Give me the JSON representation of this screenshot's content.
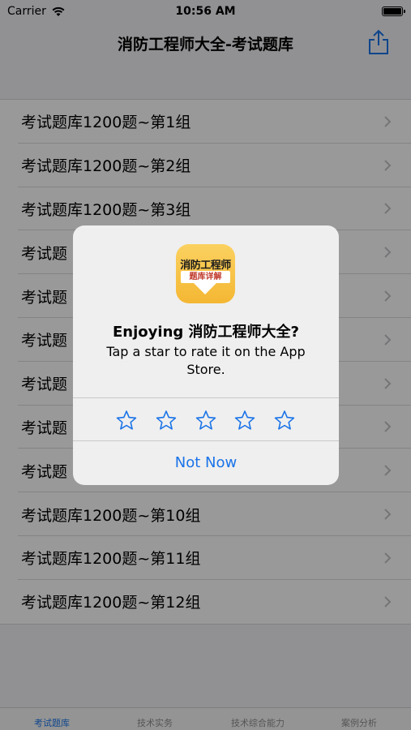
{
  "status_bar": {
    "carrier": "Carrier",
    "time": "10:56 AM"
  },
  "nav": {
    "title": "消防工程师大全-考试题库",
    "share_icon": "share-icon"
  },
  "list": {
    "items": [
      {
        "label": "考试题库1200题~第1组"
      },
      {
        "label": "考试题库1200题~第2组"
      },
      {
        "label": "考试题库1200题~第3组"
      },
      {
        "label": "考试题"
      },
      {
        "label": "考试题"
      },
      {
        "label": "考试题"
      },
      {
        "label": "考试题"
      },
      {
        "label": "考试题"
      },
      {
        "label": "考试题"
      },
      {
        "label": "考试题库1200题~第10组"
      },
      {
        "label": "考试题库1200题~第11组"
      },
      {
        "label": "考试题库1200题~第12组"
      }
    ]
  },
  "tab_bar": {
    "tabs": [
      {
        "label": "考试题库",
        "active": true
      },
      {
        "label": "技术实务",
        "active": false
      },
      {
        "label": "技术综合能力",
        "active": false
      },
      {
        "label": "案例分析",
        "active": false
      }
    ]
  },
  "alert": {
    "icon_title": "消防工程师",
    "icon_band": "题库详解",
    "title": "Enjoying 消防工程师大全?",
    "message": "Tap a star to rate it on the App Store.",
    "star_count": 5,
    "not_now": "Not Now"
  },
  "colors": {
    "accent": "#1a73e8",
    "overlay": "rgba(0,0,0,0.4)",
    "icon_bg": "#f4b733"
  }
}
